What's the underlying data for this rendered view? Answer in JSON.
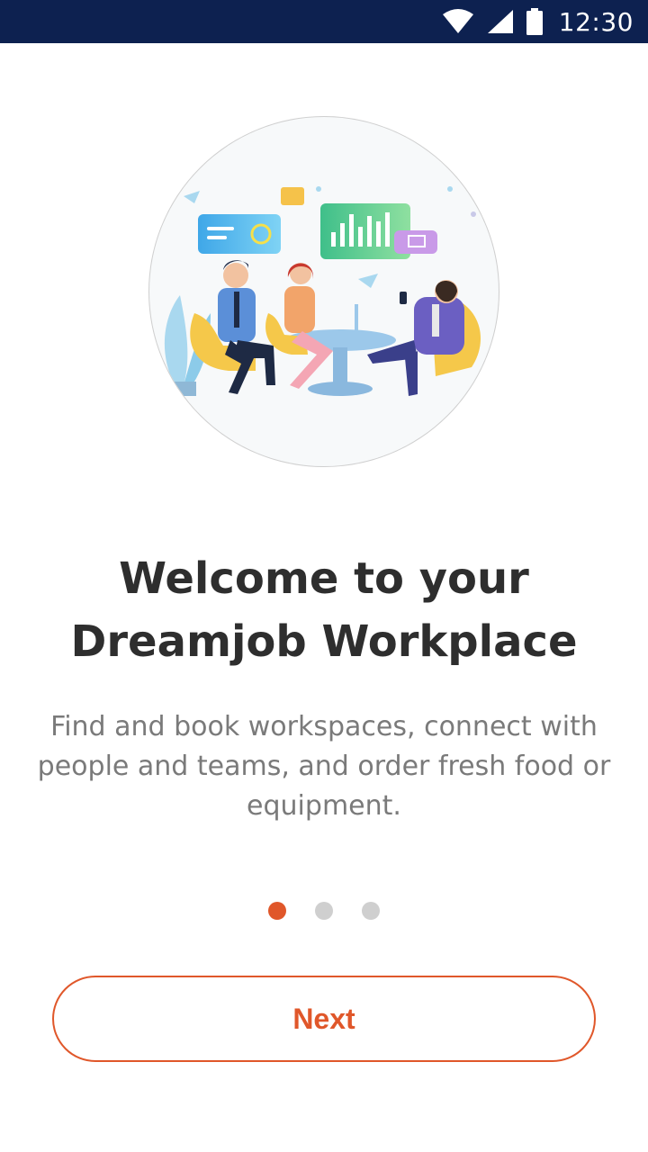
{
  "status_bar": {
    "time": "12:30",
    "icons": [
      "wifi-icon",
      "cellular-signal-icon",
      "battery-icon"
    ],
    "background": "#0d2150"
  },
  "onboarding": {
    "illustration": "team-meeting-illustration",
    "title_line1": "Welcome to your",
    "title_line2": "Dreamjob Workplace",
    "description": "Find and book workspaces, connect with people and teams, and order fresh food or equipment.",
    "page_count": 3,
    "current_page": 1,
    "next_label": "Next"
  },
  "colors": {
    "accent": "#e0572a",
    "title": "#2e2e2e",
    "body_text": "#7a7a7a",
    "dot_inactive": "#cfcfcf"
  }
}
